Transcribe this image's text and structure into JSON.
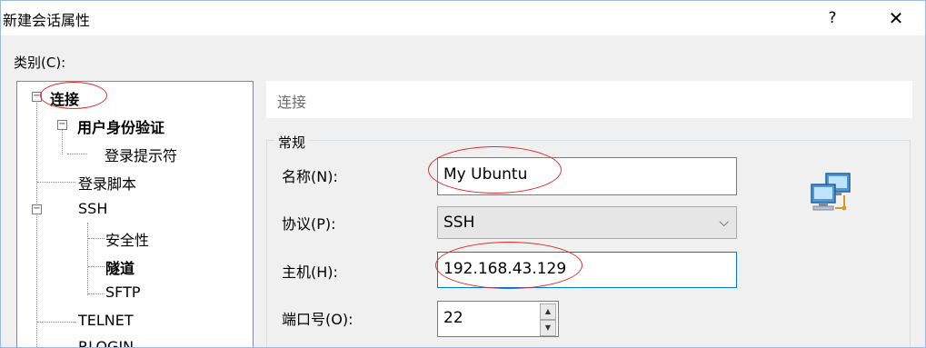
{
  "window": {
    "title": "新建会话属性",
    "help_symbol": "?",
    "close_symbol": "✕"
  },
  "category_label": "类别(C):",
  "tree": {
    "items": [
      {
        "label": "连接",
        "expander": "−"
      },
      {
        "label": "用户身份验证",
        "expander": "−"
      },
      {
        "label": "登录提示符"
      },
      {
        "label": "登录脚本"
      },
      {
        "label": "SSH",
        "expander": "−"
      },
      {
        "label": "安全性"
      },
      {
        "label": "隧道"
      },
      {
        "label": "SFTP"
      },
      {
        "label": "TELNET"
      },
      {
        "label": "RLOGIN"
      }
    ]
  },
  "section_title": "连接",
  "general": {
    "group_label": "常规",
    "name_label": "名称(N):",
    "name_value": "My Ubuntu",
    "protocol_label": "协议(P):",
    "protocol_value": "SSH",
    "host_label": "主机(H):",
    "host_value": "192.168.43.129",
    "port_label": "端口号(O):",
    "port_value": "22"
  },
  "icons": {
    "up": "▲",
    "down": "▼",
    "chevron": "⌵",
    "connection_icon": "network-computers-icon"
  },
  "colors": {
    "annotation": "#e32d2d",
    "focus": "#0078d7",
    "header_text": "#6d6d6d"
  }
}
